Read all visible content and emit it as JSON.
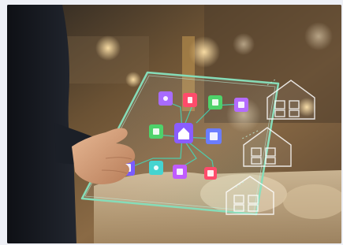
{
  "image": {
    "subject": "hand-holding-glass-tablet-smart-home-interface",
    "icon_names": [
      "light-bulb-icon",
      "thermostat-icon",
      "lock-icon",
      "video-camera-icon",
      "wifi-icon",
      "home-icon",
      "socket-icon",
      "speaker-icon",
      "tv-icon",
      "shield-icon",
      "fan-icon"
    ],
    "colors": {
      "background_warm": "#6b4f33",
      "glass_edge": "#7fd6b7",
      "icon_purple": "#a86bff",
      "icon_green": "#4ed26a",
      "icon_red": "#ff4b6b",
      "icon_teal": "#45d4d0",
      "suit_dark": "#15181f"
    }
  }
}
